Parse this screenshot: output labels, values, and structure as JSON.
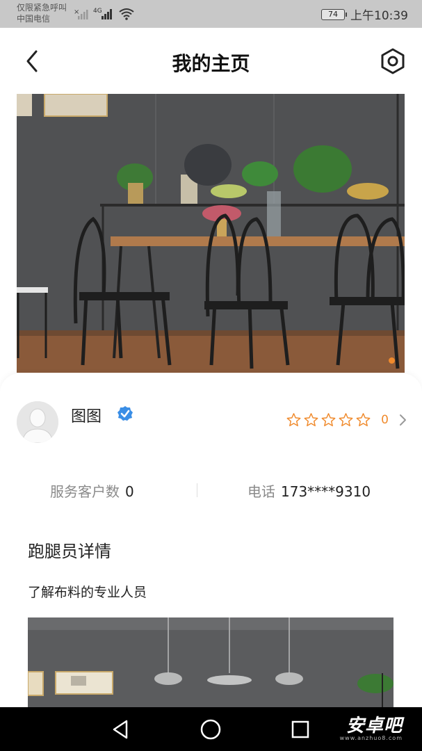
{
  "status_bar": {
    "line1": "仅限紧急呼叫",
    "line2": "中国电信",
    "network": "4G",
    "battery": "74",
    "time": "上午10:39"
  },
  "header": {
    "title": "我的主页",
    "back_icon": "chevron-left-icon",
    "settings_icon": "hexagon-settings-icon"
  },
  "banner": {
    "indicator_color": "#f08a2c"
  },
  "profile": {
    "name": "图图",
    "verified": true,
    "rating_count": 0,
    "rating_value": "0",
    "star_color": "#f08a2c"
  },
  "stats": {
    "customers_label": "服务客户数",
    "customers_value": "0",
    "phone_label": "电话",
    "phone_value": "173****9310"
  },
  "details": {
    "title": "跑腿员详情",
    "description": "了解布料的专业人员"
  },
  "watermark": {
    "brand": "安卓吧",
    "domain": "www.anzhuo8.com"
  }
}
